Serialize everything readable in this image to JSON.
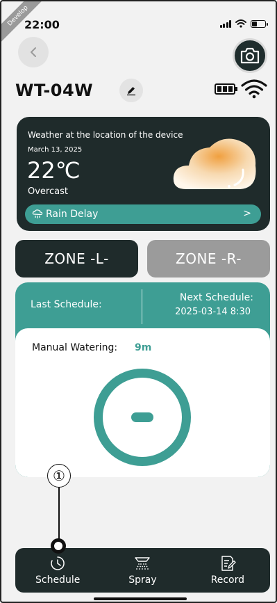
{
  "status_bar": {
    "dev_label": "Develop",
    "time": "22:00"
  },
  "header": {
    "device_name": "WT-04W",
    "back_icon": "chevron-left-icon",
    "camera_icon": "camera-icon",
    "edit_icon": "pencil-icon",
    "battery_icon": "battery-icon",
    "wifi_icon": "wifi-icon"
  },
  "weather": {
    "heading": "Weather at the location of the device",
    "date": "March 13, 2025",
    "temperature": "22℃",
    "condition": "Overcast",
    "rain_delay_label": "Rain Delay",
    "rain_delay_chevron": ">"
  },
  "zones": {
    "left": "ZONE -L-",
    "right": "ZONE -R-"
  },
  "schedule": {
    "last_label": "Last Schedule:",
    "next_label": "Next Schedule:",
    "next_value": "2025-03-14 8:30"
  },
  "watering": {
    "manual_label": "Manual Watering:",
    "manual_value": "9m"
  },
  "callout": {
    "number": "①"
  },
  "nav": {
    "items": [
      {
        "label": "Schedule",
        "icon": "clock-icon"
      },
      {
        "label": "Spray",
        "icon": "spray-icon"
      },
      {
        "label": "Record",
        "icon": "record-icon"
      }
    ]
  },
  "colors": {
    "dark": "#1f2b2b",
    "teal": "#3e9e94",
    "gray": "#9b9b9b",
    "background": "#f2f2f2"
  }
}
